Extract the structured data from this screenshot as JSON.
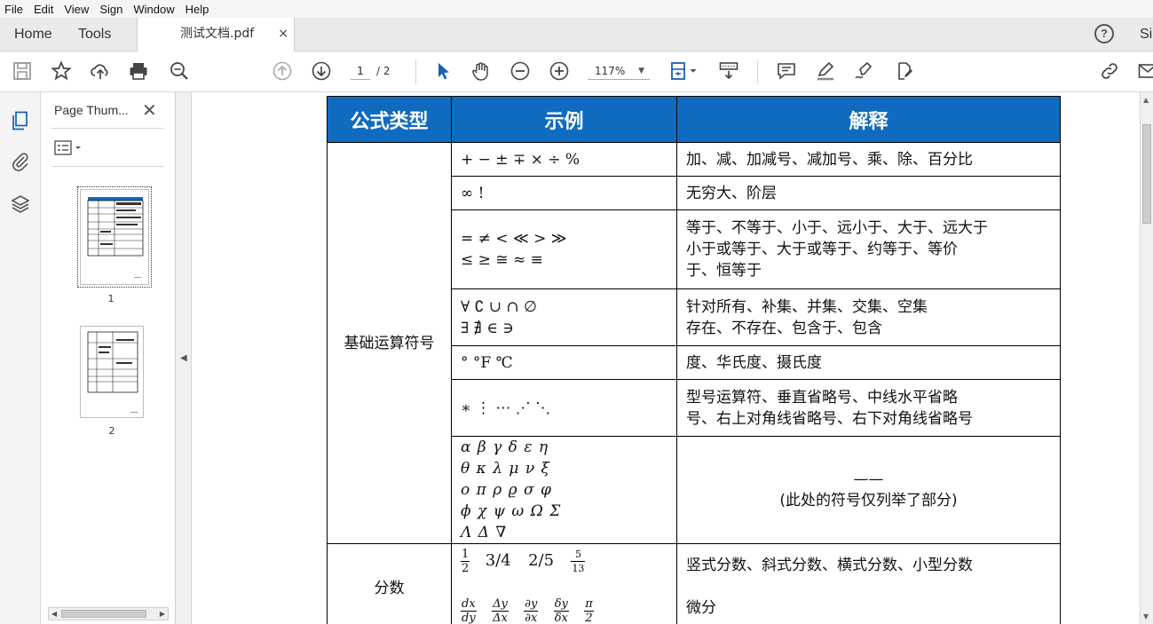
{
  "menu": [
    "File",
    "Edit",
    "View",
    "Sign",
    "Window",
    "Help"
  ],
  "tabs": {
    "home": "Home",
    "tools": "Tools",
    "document": "测试文档.pdf",
    "close": "×",
    "help": "?",
    "signin": "Si"
  },
  "toolbar": {
    "current_page": "1",
    "total_pages": "/ 2",
    "zoom": "117%",
    "zoom_dropdown": "▼"
  },
  "thumbnails": {
    "title": "Page Thum...",
    "close": "✕",
    "pages": [
      "1",
      "2"
    ]
  },
  "table": {
    "headers": [
      "公式类型",
      "示例",
      "解释"
    ],
    "categories": [
      "基础运算符号",
      "分数"
    ],
    "rows": [
      {
        "example": [
          "+ − ± ∓ × ÷ %"
        ],
        "explanation": [
          "加、减、加减号、减加号、乘、除、百分比"
        ]
      },
      {
        "example": [
          "∞ !"
        ],
        "explanation": [
          "无穷大、阶层"
        ]
      },
      {
        "example": [
          "= ≠ < ≪ > ≫",
          "≤ ≥ ≅  ≈  ≡"
        ],
        "explanation": [
          "等于、不等于、小于、远小于、大于、远大于",
          "小于或等于、大于或等于、约等于、等价",
          "于、恒等于"
        ]
      },
      {
        "example": [
          "∀ ∁  ∪  ∩  ∅",
          "∃ ∄ ∈ ∋"
        ],
        "explanation": [
          "针对所有、补集、并集、交集、空集",
          "存在、不存在、包含于、包含"
        ]
      },
      {
        "example": [
          "°  °F  ℃"
        ],
        "explanation": [
          "度、华氏度、摄氏度"
        ]
      },
      {
        "example": [
          "∗ ⋮ ⋯ ⋰ ⋱"
        ],
        "explanation": [
          "型号运算符、垂直省略号、中线水平省略",
          "号、右上对角线省略号、右下对角线省略号"
        ]
      },
      {
        "example": [
          "α  β  γ  δ  ε  η",
          "θ  κ  λ  μ  ν  ξ",
          "ο  π  ρ  ϱ  σ  φ",
          "ϕ  χ  ψ  ω  Ω  Σ",
          "Λ  Δ  ∇"
        ],
        "explanation": [
          "——",
          "(此处的符号仅列举了部分)"
        ]
      }
    ],
    "fractions": {
      "simple": [
        {
          "n": "1",
          "d": "2"
        },
        {
          "label": "3/4"
        },
        {
          "label": "2/5"
        },
        {
          "n": "5",
          "d": "13"
        }
      ],
      "diff": [
        {
          "n": "dx",
          "d": "dy"
        },
        {
          "n": "Δy",
          "d": "Δx"
        },
        {
          "n": "∂y",
          "d": "∂x"
        },
        {
          "n": "δy",
          "d": "δx"
        },
        {
          "n": "π",
          "d": "2"
        }
      ],
      "explanation": [
        "竖式分数、斜式分数、横式分数、小型分数",
        "微分"
      ]
    }
  },
  "colors": {
    "header_blue": "#0f6bbf",
    "toolbar_bg": "#eaeaea"
  }
}
